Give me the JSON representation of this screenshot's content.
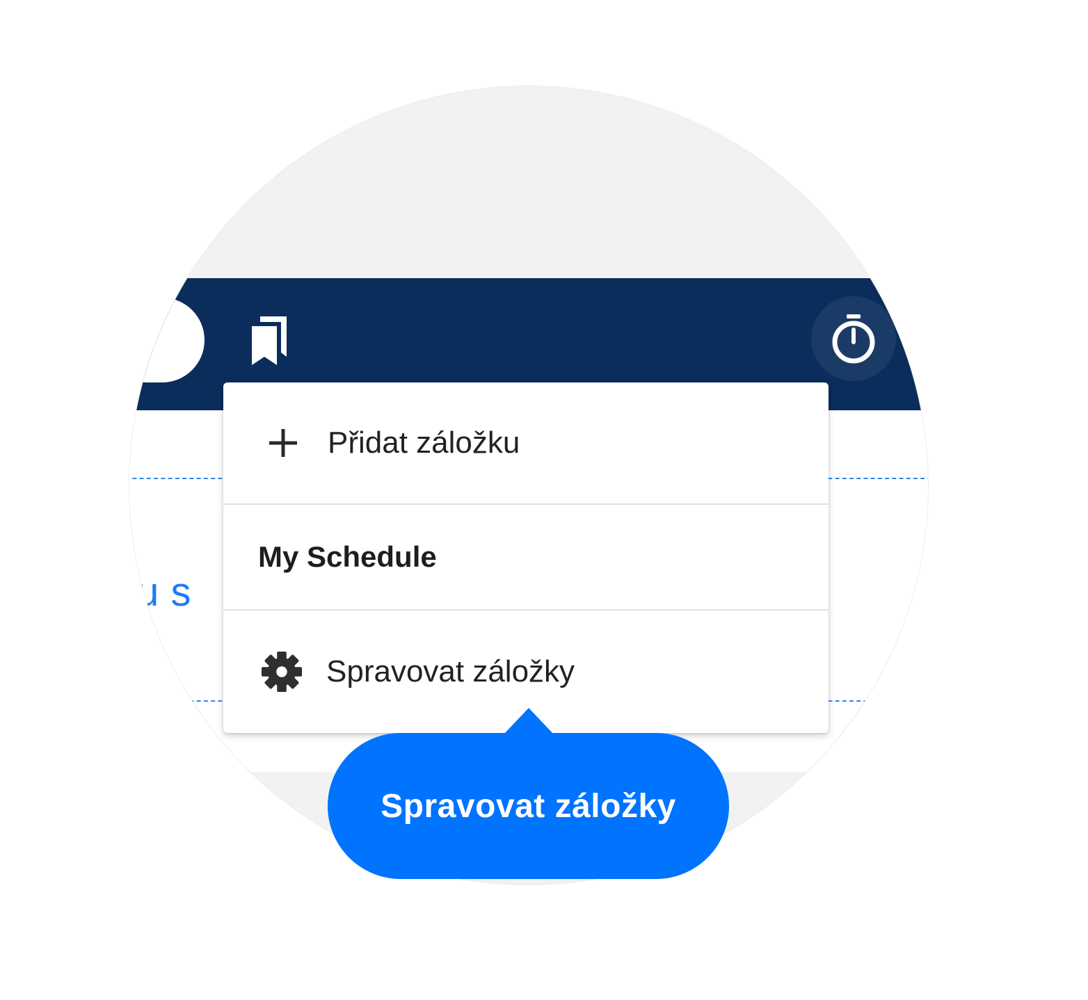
{
  "header": {
    "bookmarks_icon": "bookmarks-icon",
    "timer_icon": "stopwatch-icon"
  },
  "background": {
    "partial_link_text": "olu s"
  },
  "bookmarks_menu": {
    "items": [
      {
        "icon": "plus-icon",
        "label": "Přidat záložku"
      },
      {
        "label": "My Schedule"
      },
      {
        "icon": "gear-icon",
        "label": "Spravovat záložky"
      }
    ]
  },
  "callout": {
    "label": "Spravovat záložky"
  },
  "colors": {
    "header_bg": "#0b2d5b",
    "accent": "#0073ff",
    "link": "#1d7cf2"
  }
}
